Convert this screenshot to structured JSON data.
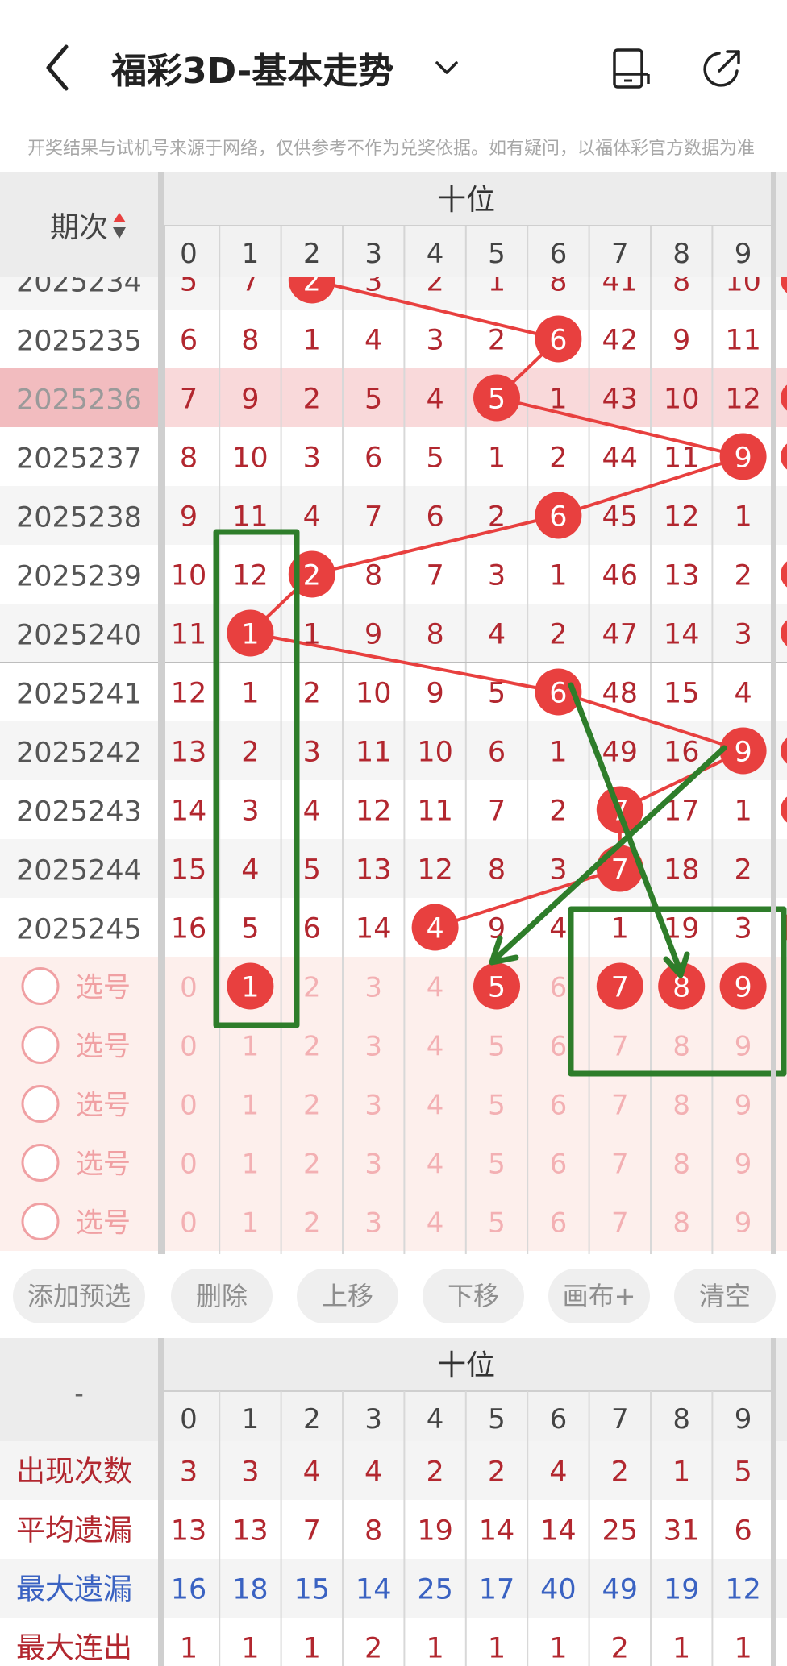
{
  "header": {
    "title": "福彩3D-基本走势",
    "icons": [
      "back-arrow-icon",
      "chevron-down-icon",
      "phone-mode-icon",
      "share-icon"
    ]
  },
  "disclaimer": "开奖结果与试机号来源于网络，仅供参考不作为兑奖依据。如有疑问，以福体彩官方数据为准",
  "trend": {
    "issue_header": "期次",
    "group_header": "十位",
    "digits": [
      "0",
      "1",
      "2",
      "3",
      "4",
      "5",
      "6",
      "7",
      "8",
      "9"
    ],
    "partial_row": {
      "issue": "2025234",
      "cells": [
        "5",
        "7",
        "2",
        "3",
        "2",
        "1",
        "8",
        "41",
        "8",
        "10"
      ],
      "hit": 2
    },
    "rows": [
      {
        "issue": "2025235",
        "cells": [
          "6",
          "8",
          "1",
          "4",
          "3",
          "2",
          "6",
          "42",
          "9",
          "11"
        ],
        "hit": 6
      },
      {
        "issue": "2025236",
        "cells": [
          "7",
          "9",
          "2",
          "5",
          "4",
          "5",
          "1",
          "43",
          "10",
          "12"
        ],
        "hit": 5
      },
      {
        "issue": "2025237",
        "cells": [
          "8",
          "10",
          "3",
          "6",
          "5",
          "1",
          "2",
          "44",
          "11",
          "9"
        ],
        "hit": 9
      },
      {
        "issue": "2025238",
        "cells": [
          "9",
          "11",
          "4",
          "7",
          "6",
          "2",
          "6",
          "45",
          "12",
          "1"
        ],
        "hit": 6
      },
      {
        "issue": "2025239",
        "cells": [
          "10",
          "12",
          "2",
          "8",
          "7",
          "3",
          "1",
          "46",
          "13",
          "2"
        ],
        "hit": 2
      },
      {
        "issue": "2025240",
        "cells": [
          "11",
          "1",
          "1",
          "9",
          "8",
          "4",
          "2",
          "47",
          "14",
          "3"
        ],
        "hit": 1
      },
      {
        "issue": "2025241",
        "cells": [
          "12",
          "1",
          "2",
          "10",
          "9",
          "5",
          "6",
          "48",
          "15",
          "4"
        ],
        "hit": 6
      },
      {
        "issue": "2025242",
        "cells": [
          "13",
          "2",
          "3",
          "11",
          "10",
          "6",
          "1",
          "49",
          "16",
          "9"
        ],
        "hit": 9
      },
      {
        "issue": "2025243",
        "cells": [
          "14",
          "3",
          "4",
          "12",
          "11",
          "7",
          "2",
          "7",
          "17",
          "1"
        ],
        "hit": 7
      },
      {
        "issue": "2025244",
        "cells": [
          "15",
          "4",
          "5",
          "13",
          "12",
          "8",
          "3",
          "7",
          "18",
          "2"
        ],
        "hit": 7
      },
      {
        "issue": "2025245",
        "cells": [
          "16",
          "5",
          "6",
          "14",
          "4",
          "9",
          "4",
          "1",
          "19",
          "3"
        ],
        "hit": 4
      }
    ],
    "selected_issue": "2025236",
    "select_label": "选号",
    "select_rows": [
      {
        "cells": [
          "0",
          "1",
          "2",
          "3",
          "4",
          "5",
          "6",
          "7",
          "8",
          "9"
        ],
        "selected": [
          1,
          5,
          7,
          8,
          9
        ]
      },
      {
        "cells": [
          "0",
          "1",
          "2",
          "3",
          "4",
          "5",
          "6",
          "7",
          "8",
          "9"
        ],
        "selected": []
      },
      {
        "cells": [
          "0",
          "1",
          "2",
          "3",
          "4",
          "5",
          "6",
          "7",
          "8",
          "9"
        ],
        "selected": []
      },
      {
        "cells": [
          "0",
          "1",
          "2",
          "3",
          "4",
          "5",
          "6",
          "7",
          "8",
          "9"
        ],
        "selected": []
      },
      {
        "cells": [
          "0",
          "1",
          "2",
          "3",
          "4",
          "5",
          "6",
          "7",
          "8",
          "9"
        ],
        "selected": []
      }
    ]
  },
  "actions": [
    "添加预选",
    "删除",
    "上移",
    "下移",
    "画布+",
    "清空"
  ],
  "stats": {
    "corner": "-",
    "group_header": "十位",
    "digits": [
      "0",
      "1",
      "2",
      "3",
      "4",
      "5",
      "6",
      "7",
      "8",
      "9"
    ],
    "rows": [
      {
        "label": "出现次数",
        "values": [
          "3",
          "3",
          "4",
          "4",
          "2",
          "2",
          "4",
          "2",
          "1",
          "5"
        ],
        "color": "#b2272f"
      },
      {
        "label": "平均遗漏",
        "values": [
          "13",
          "13",
          "7",
          "8",
          "19",
          "14",
          "14",
          "25",
          "31",
          "6"
        ],
        "color": "#b2272f"
      },
      {
        "label": "最大遗漏",
        "values": [
          "16",
          "18",
          "15",
          "14",
          "25",
          "17",
          "40",
          "49",
          "19",
          "12"
        ],
        "color": "#3a62c2"
      },
      {
        "label": "最大连出",
        "values": [
          "1",
          "1",
          "1",
          "2",
          "1",
          "1",
          "1",
          "2",
          "1",
          "1"
        ],
        "color": "#b2272f"
      }
    ]
  },
  "colors": {
    "ball": "#e8403f",
    "line": "#e8403f",
    "missing_value": "#b2272f",
    "selected_row_bg": "#f9d9da",
    "select_area_bg": "#fdefec",
    "annotation_green": "#2e7d2a",
    "max_missing": "#3a62c2"
  }
}
